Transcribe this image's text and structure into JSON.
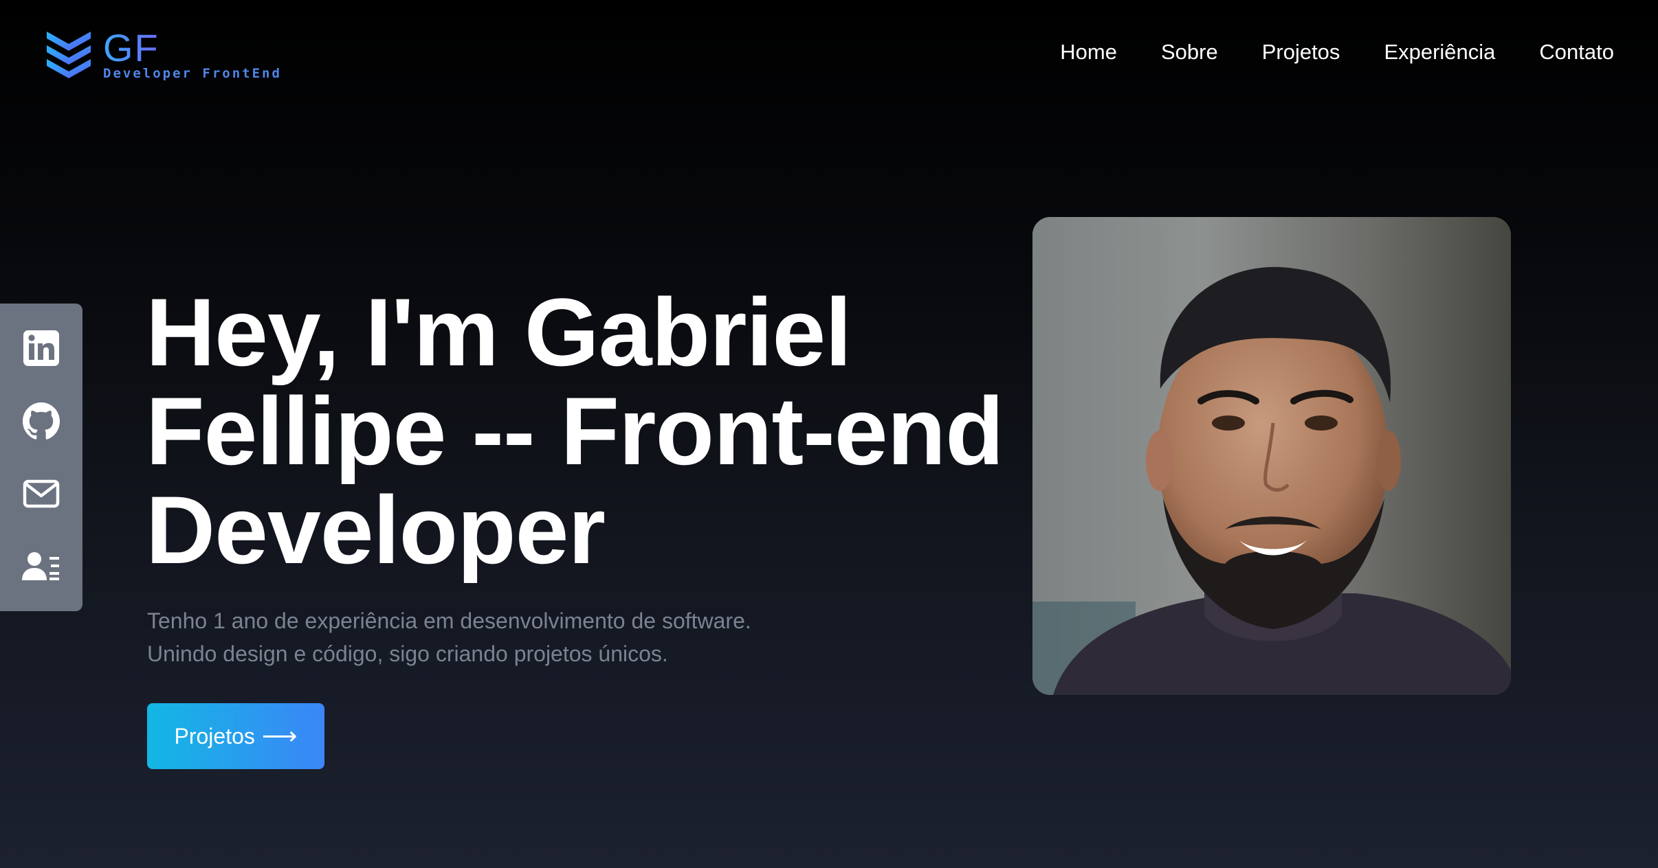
{
  "logo": {
    "initials": "GF",
    "tagline": "Developer FrontEnd",
    "icon": "stacked-chevrons-logo-icon"
  },
  "nav": {
    "items": [
      {
        "label": "Home"
      },
      {
        "label": "Sobre"
      },
      {
        "label": "Projetos"
      },
      {
        "label": "Experiência"
      },
      {
        "label": "Contato"
      }
    ]
  },
  "social": {
    "items": [
      {
        "icon": "linkedin-icon"
      },
      {
        "icon": "github-icon"
      },
      {
        "icon": "mail-icon"
      },
      {
        "icon": "contact-card-icon"
      }
    ]
  },
  "hero": {
    "title_lines": [
      "Hey, I'm Gabriel",
      "Fellipe -- Front-end",
      "Developer"
    ],
    "description_lines": [
      "Tenho 1 ano de experiência em desenvolvimento de software.",
      "Unindo design e código, sigo criando projetos únicos."
    ],
    "cta_label": "Projetos",
    "cta_icon": "arrow-right-icon"
  },
  "photo": {
    "subject": "profile-photo"
  },
  "colors": {
    "accent_start": "#13b7e3",
    "accent_end": "#3b86f7",
    "sidebar_bg": "#6b7280",
    "muted_text": "#7b8393",
    "logo_blue": "#4f86e8"
  }
}
